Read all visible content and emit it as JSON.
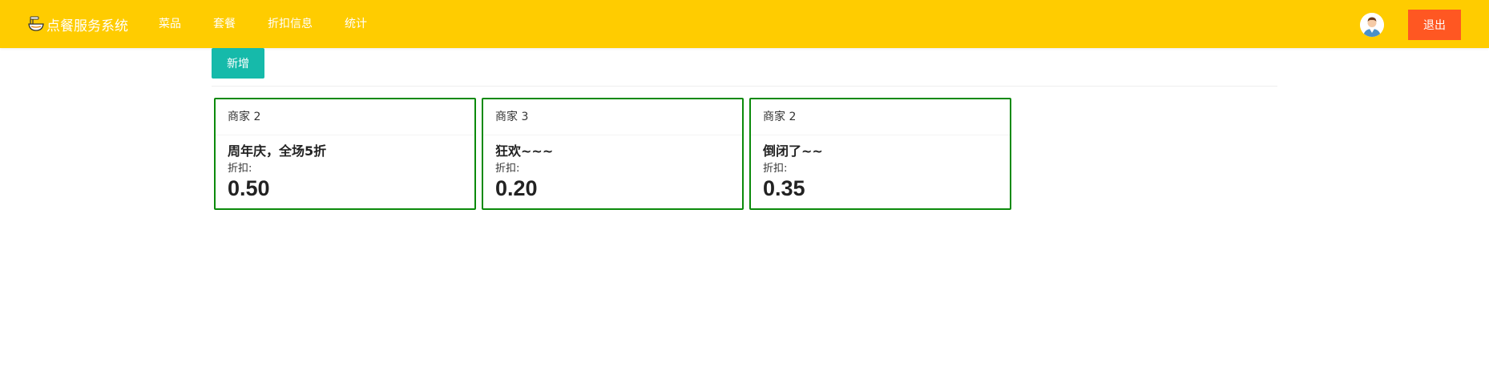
{
  "header": {
    "app_title": "点餐服务系统",
    "nav": [
      "菜品",
      "套餐",
      "折扣信息",
      "统计"
    ],
    "logout_label": "退出",
    "background_color": "#ffcc00",
    "logout_color": "#ff5722"
  },
  "toolbar": {
    "add_label": "新增",
    "add_color": "#16baaa"
  },
  "discounts": [
    {
      "merchant": "商家 2",
      "title": "周年庆，全场5折",
      "label": "折扣:",
      "value": "0.50"
    },
    {
      "merchant": "商家 3",
      "title": "狂欢~~~",
      "label": "折扣:",
      "value": "0.20"
    },
    {
      "merchant": "商家 2",
      "title": "倒闭了~~",
      "label": "折扣:",
      "value": "0.35"
    }
  ],
  "card_border_color": "#0b8a0b",
  "icons": {
    "logo": "noodle-bowl-icon",
    "avatar": "user-avatar"
  }
}
